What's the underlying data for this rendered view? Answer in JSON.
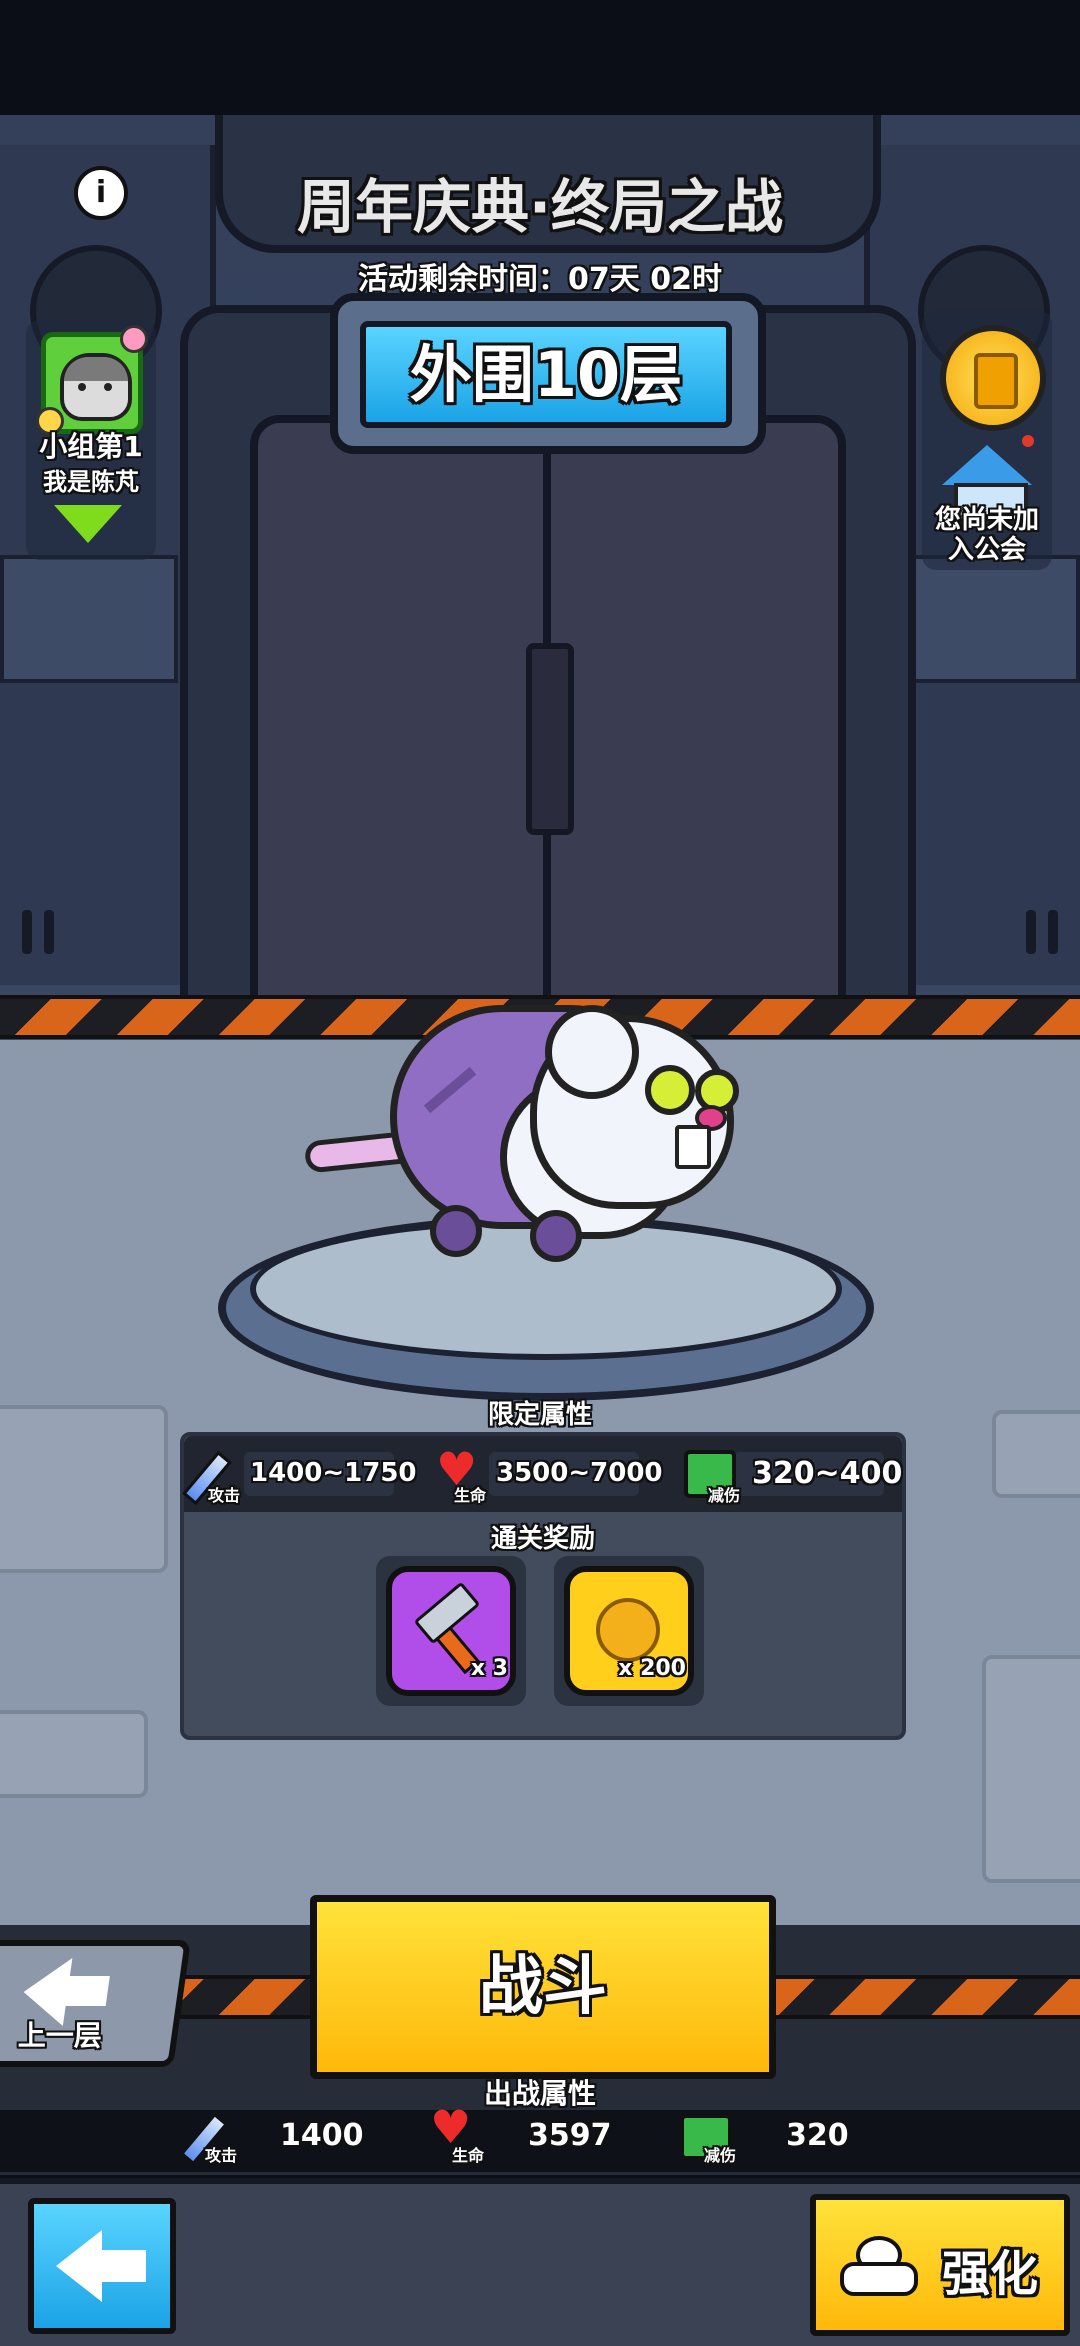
{
  "header": {
    "title": "周年庆典·终局之战",
    "timer": "活动剩余时间：07天 02时",
    "floor_label": "外围10层"
  },
  "left_panel": {
    "rank": "小组第1",
    "player_name": "我是陈芃"
  },
  "right_panel": {
    "guild_status": "您尚未加入公会"
  },
  "limited_attributes": {
    "title": "限定属性",
    "attack_tag": "攻击",
    "attack": "1400~1750",
    "hp_tag": "生命",
    "hp": "3500~7000",
    "defense_tag": "减伤",
    "defense": "320~400"
  },
  "rewards": {
    "title": "通关奖励",
    "items": [
      {
        "icon": "hammer-icon",
        "count": "x 3"
      },
      {
        "icon": "gold-coin-icon",
        "count": "x 200"
      }
    ]
  },
  "battle": {
    "prev_floor_label": "上一层",
    "fight_label": "战斗",
    "stats_title": "出战属性",
    "attack_tag": "攻击",
    "attack": "1400",
    "hp_tag": "生命",
    "hp": "3597",
    "defense_tag": "减伤",
    "defense": "320"
  },
  "bottom_bar": {
    "upgrade_label": "强化"
  },
  "colors": {
    "accent_yellow": "#ffd21a",
    "accent_blue": "#22b8f0",
    "panel_dark": "#3d4656"
  }
}
